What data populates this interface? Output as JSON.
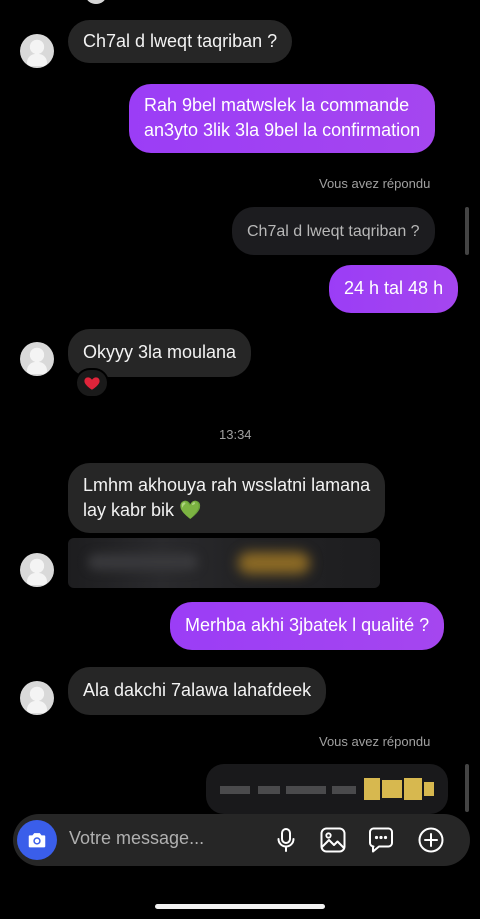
{
  "messages": {
    "m1": "Ch7al d lweqt taqriban ?",
    "m2_line1": "Rah 9bel matwslek la commande",
    "m2_line2": "an3yto 3lik 3la 9bel la confirmation",
    "reply_label_1": "Vous avez répondu",
    "quoted_1": "Ch7al d lweqt taqriban ?",
    "m3": "24 h tal 48 h",
    "m4": "Okyyy 3la moulana",
    "time_1": "13:34",
    "m5_line1": "Lmhm akhouya rah wsslatni lamana",
    "m5_line2": "lay kabr bik 💚",
    "m6": "Merhba akhi 3jbatek l qualité ?",
    "m7": "Ala dakchi 7alawa lahafdeek",
    "reply_label_2": "Vous avez répondu"
  },
  "composer": {
    "placeholder": "Votre message..."
  },
  "icons": {
    "camera": "camera-icon",
    "mic": "microphone-icon",
    "gallery": "image-icon",
    "sticker": "sticker-icon",
    "add": "plus-circle-icon",
    "reaction": "red-heart"
  },
  "colors": {
    "outgoing_bubble": "#a43ff2",
    "incoming_bubble": "#262626",
    "camera_button": "#3a5eea"
  }
}
